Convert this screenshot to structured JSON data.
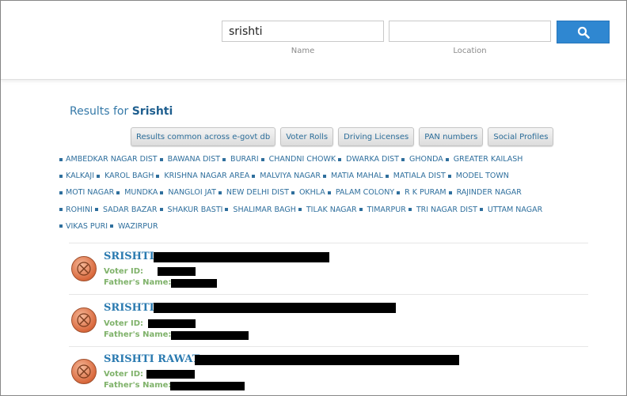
{
  "search": {
    "name_value": "srishti",
    "name_caption": "Name",
    "location_value": "",
    "location_caption": "Location",
    "button_icon": "search-icon"
  },
  "results": {
    "prefix": "Results for",
    "query": "Srishti"
  },
  "tabs": [
    {
      "label": "Results common across e-govt db"
    },
    {
      "label": "Voter Rolls"
    },
    {
      "label": "Driving Licenses"
    },
    {
      "label": "PAN numbers"
    },
    {
      "label": "Social Profiles"
    }
  ],
  "location_rows": [
    [
      "AMBEDKAR NAGAR DIST",
      "BAWANA DIST",
      "BURARI",
      "CHANDNI CHOWK",
      "DWARKA DIST",
      "GHONDA",
      "GREATER KAILASH"
    ],
    [
      "KALKAJI",
      "KAROL BAGH",
      "KRISHNA NAGAR AREA",
      "MALVIYA NAGAR",
      "MATIA MAHAL",
      "MATIALA DIST",
      "MODEL TOWN"
    ],
    [
      "MOTI NAGAR",
      "MUNDKA",
      "NANGLOI JAT",
      "NEW DELHI DIST",
      "OKHLA",
      "PALAM COLONY",
      "R K PURAM",
      "RAJINDER NAGAR"
    ],
    [
      "ROHINI",
      "SADAR BAZAR",
      "SHAKUR BASTI",
      "SHALIMAR BAGH",
      "TILAK NAGAR",
      "TIMARPUR",
      "TRI NAGAR DIST",
      "UTTAM NAGAR"
    ],
    [
      "VIKAS PURI",
      "WAZIRPUR"
    ]
  ],
  "people": [
    {
      "name": "SRISHTI,",
      "voter_label": "Voter ID:",
      "father_label": "Father's Name:"
    },
    {
      "name": "SRISHTI,",
      "voter_label": "Voter ID:",
      "father_label": "Father's Name:"
    },
    {
      "name": "SRISHTI RAWAT,",
      "voter_label": "Voter ID:",
      "father_label": "Father's Name:"
    }
  ],
  "colors": {
    "accent": "#2f87d1",
    "link": "#2f6f9d",
    "label_green": "#7fb26a"
  }
}
